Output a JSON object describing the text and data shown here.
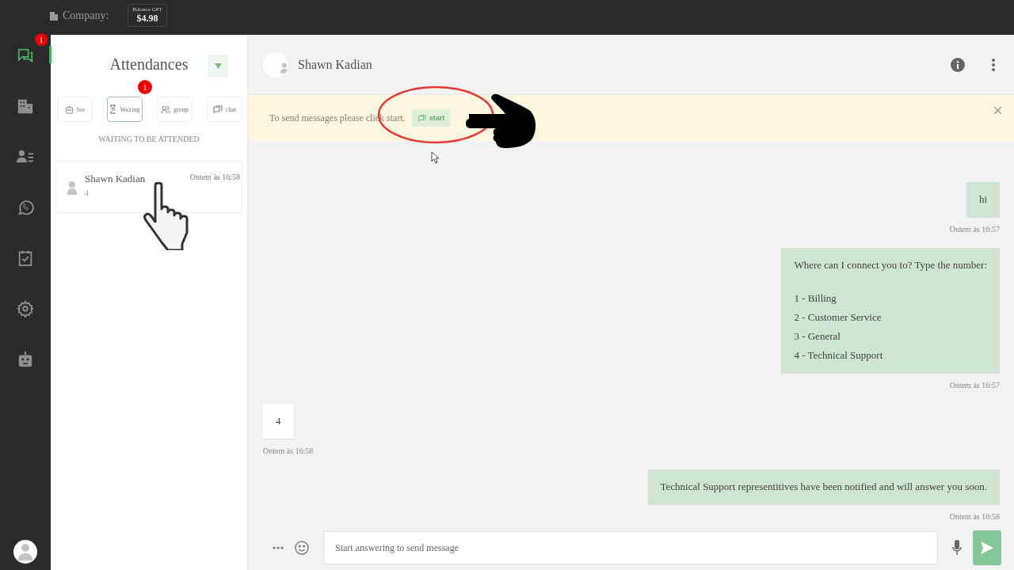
{
  "top_bar": {
    "company_label": "Company:",
    "balance": {
      "label": "Balance GPT",
      "value": "$4.98"
    }
  },
  "nav": [
    {
      "kind": "chat",
      "selected": true,
      "badge": "1"
    },
    {
      "kind": "building",
      "selected": false
    },
    {
      "kind": "contacts",
      "selected": false
    },
    {
      "kind": "whatsapp",
      "selected": false
    },
    {
      "kind": "calendar",
      "selected": false
    },
    {
      "kind": "settings",
      "selected": false
    },
    {
      "kind": "robot",
      "selected": false
    }
  ],
  "sidebar": {
    "title": "Attendances",
    "section_label": "WAITING TO BE ATTENDED",
    "tabs": [
      {
        "kind": "bot",
        "label": "bot",
        "selected": false
      },
      {
        "kind": "waiting",
        "label": "Waiting",
        "selected": true,
        "badge": "1"
      },
      {
        "kind": "group",
        "label": "group",
        "selected": false
      },
      {
        "kind": "chat",
        "label": "chat",
        "selected": false
      }
    ],
    "tickets": [
      {
        "name": "Shawn Kadian",
        "last_message": "4",
        "time": "Ontem às 16:58"
      }
    ]
  },
  "chat": {
    "contact_name": "Shawn Kadian",
    "banner": {
      "text": "To send messages please click start.",
      "button": "start"
    },
    "messages": [
      {
        "outgoing": true,
        "lines": [
          "hi"
        ],
        "time": "Ontem às 16:57"
      },
      {
        "outgoing": true,
        "lines": [
          "Where can I connect you to? Type the number:"
        ],
        "options": [
          "1 - Billing",
          "2 - Customer Service",
          "3 - General",
          "4 - Technical Support"
        ],
        "time": "Ontem às 16:57"
      },
      {
        "outgoing": false,
        "lines": [
          "4"
        ],
        "time": "Ontem às 16:58"
      },
      {
        "outgoing": true,
        "lines": [
          "Technical Support representitives have been notified and will answer you soon."
        ],
        "time": "Ontem às 16:58"
      }
    ],
    "composer": {
      "placeholder": "Start answering to send message"
    }
  }
}
